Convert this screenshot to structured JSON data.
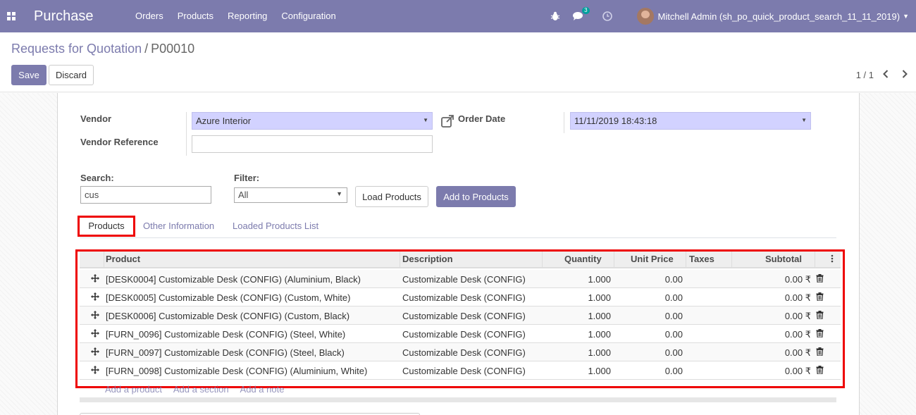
{
  "navbar": {
    "app_name": "Purchase",
    "menu": [
      "Orders",
      "Products",
      "Reporting",
      "Configuration"
    ],
    "messages_badge": "3",
    "user": "Mitchell Admin (sh_po_quick_product_search_11_11_2019)",
    "color": "#7c7bad"
  },
  "breadcrumb": {
    "parent": "Requests for Quotation",
    "separator": "/",
    "current": "P00010"
  },
  "buttons": {
    "save": "Save",
    "discard": "Discard",
    "load_products": "Load Products",
    "add_to_products": "Add to Products"
  },
  "pager": {
    "text": "1 / 1"
  },
  "form": {
    "vendor_label": "Vendor",
    "vendor_value": "Azure Interior",
    "vendor_reference_label": "Vendor Reference",
    "vendor_reference_value": "",
    "order_date_label": "Order Date",
    "order_date_value": "11/11/2019 18:43:18",
    "search_label": "Search:",
    "search_value": "cus",
    "filter_label": "Filter:",
    "filter_value": "All"
  },
  "tabs": [
    "Products",
    "Other Information",
    "Loaded Products List"
  ],
  "table": {
    "columns": [
      "Product",
      "Description",
      "Quantity",
      "Unit Price",
      "Taxes",
      "Subtotal"
    ],
    "rows": [
      {
        "product": "[DESK0004] Customizable Desk (CONFIG) (Aluminium, Black)",
        "description": "Customizable Desk (CONFIG)",
        "quantity": "1.000",
        "unit_price": "0.00",
        "taxes": "",
        "subtotal": "0.00 ₹"
      },
      {
        "product": "[DESK0005] Customizable Desk (CONFIG) (Custom, White)",
        "description": "Customizable Desk (CONFIG)",
        "quantity": "1.000",
        "unit_price": "0.00",
        "taxes": "",
        "subtotal": "0.00 ₹"
      },
      {
        "product": "[DESK0006] Customizable Desk (CONFIG) (Custom, Black)",
        "description": "Customizable Desk (CONFIG)",
        "quantity": "1.000",
        "unit_price": "0.00",
        "taxes": "",
        "subtotal": "0.00 ₹"
      },
      {
        "product": "[FURN_0096] Customizable Desk (CONFIG) (Steel, White)",
        "description": "Customizable Desk (CONFIG)",
        "quantity": "1.000",
        "unit_price": "0.00",
        "taxes": "",
        "subtotal": "0.00 ₹"
      },
      {
        "product": "[FURN_0097] Customizable Desk (CONFIG) (Steel, Black)",
        "description": "Customizable Desk (CONFIG)",
        "quantity": "1.000",
        "unit_price": "0.00",
        "taxes": "",
        "subtotal": "0.00 ₹"
      },
      {
        "product": "[FURN_0098] Customizable Desk (CONFIG) (Aluminium, White)",
        "description": "Customizable Desk (CONFIG)",
        "quantity": "1.000",
        "unit_price": "0.00",
        "taxes": "",
        "subtotal": "0.00 ₹"
      }
    ],
    "add_links": [
      "Add a product",
      "Add a section",
      "Add a note"
    ]
  },
  "highlight_color": "#e00000"
}
